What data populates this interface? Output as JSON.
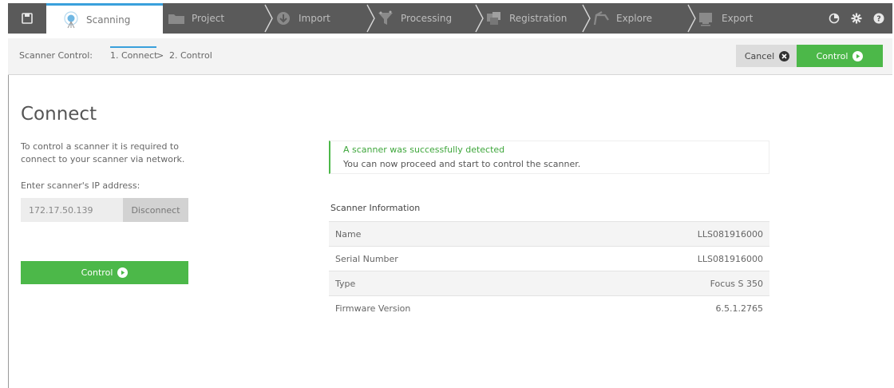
{
  "workflow_tabs": [
    {
      "label": "Scanning",
      "icon": "scanner-icon",
      "active": true
    },
    {
      "label": "Project",
      "icon": "folder-icon",
      "active": false
    },
    {
      "label": "Import",
      "icon": "import-icon",
      "active": false
    },
    {
      "label": "Processing",
      "icon": "processing-icon",
      "active": false
    },
    {
      "label": "Registration",
      "icon": "registration-icon",
      "active": false
    },
    {
      "label": "Explore",
      "icon": "explore-icon",
      "active": false
    },
    {
      "label": "Export",
      "icon": "export-icon",
      "active": false
    }
  ],
  "top_icons": [
    "pie-chart-icon",
    "gear-icon",
    "help-icon"
  ],
  "breadcrumb": {
    "label": "Scanner Control:",
    "step1": "1. Connect",
    "separator": ">",
    "step2": "2. Control"
  },
  "actions": {
    "cancel_label": "Cancel",
    "control_label": "Control"
  },
  "connect": {
    "title": "Connect",
    "description": "To control a scanner it is required to connect to your scanner via network.",
    "ip_label": "Enter scanner's IP address:",
    "ip_value": "172.17.50.139",
    "disconnect_label": "Disconnect",
    "control_label": "Control"
  },
  "status": {
    "title": "A scanner was successfully detected",
    "text": "You can now proceed and start to control the scanner."
  },
  "scanner_info": {
    "heading": "Scanner Information",
    "rows": [
      {
        "label": "Name",
        "value": "LLS081916000"
      },
      {
        "label": "Serial Number",
        "value": "LLS081916000"
      },
      {
        "label": "Type",
        "value": "Focus S 350"
      },
      {
        "label": "Firmware Version",
        "value": "6.5.1.2765"
      }
    ]
  },
  "colors": {
    "accent_green": "#4cb849",
    "accent_blue": "#3aa0dc",
    "topbar_bg": "#5a5a5a"
  }
}
